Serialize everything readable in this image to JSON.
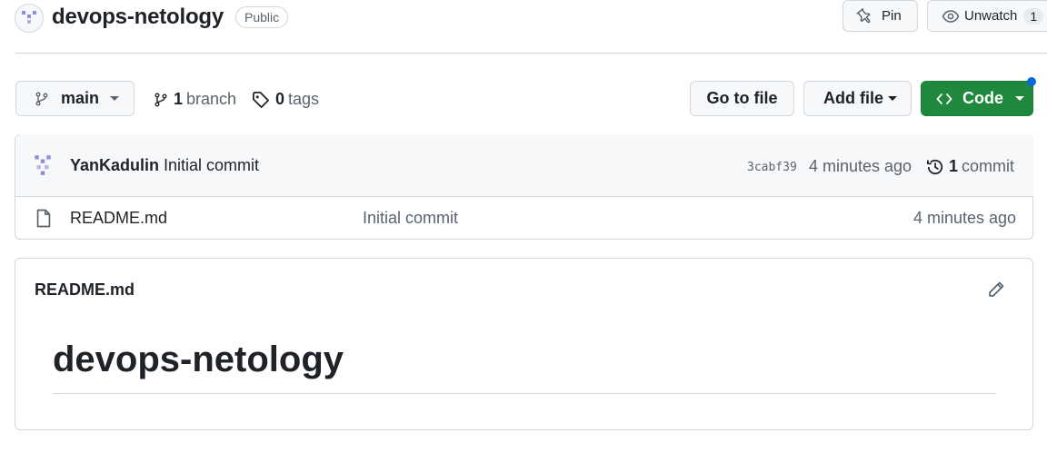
{
  "repo": {
    "name": "devops-netology",
    "visibility": "Public"
  },
  "header_actions": {
    "pin_label": "Pin",
    "unwatch_label": "Unwatch",
    "watch_count": "1"
  },
  "toolbar": {
    "branch_selector": "main",
    "branch_count": "1",
    "branch_label": "branch",
    "tag_count": "0",
    "tag_label": "tags",
    "go_to_file": "Go to file",
    "add_file": "Add file",
    "code": "Code"
  },
  "latest_commit": {
    "author": "YanKadulin",
    "message": "Initial commit",
    "sha": "3cabf39",
    "time": "4 minutes ago",
    "commit_count": "1",
    "commit_label": "commit"
  },
  "files": [
    {
      "name": "README.md",
      "message": "Initial commit",
      "time": "4 minutes ago",
      "icon": "file-icon"
    }
  ],
  "readme": {
    "filename": "README.md",
    "heading": "devops-netology"
  },
  "colors": {
    "accent_green": "#1f883d",
    "notification_dot": "#0969da",
    "border": "#d0d7de",
    "muted_text": "#59636e"
  }
}
